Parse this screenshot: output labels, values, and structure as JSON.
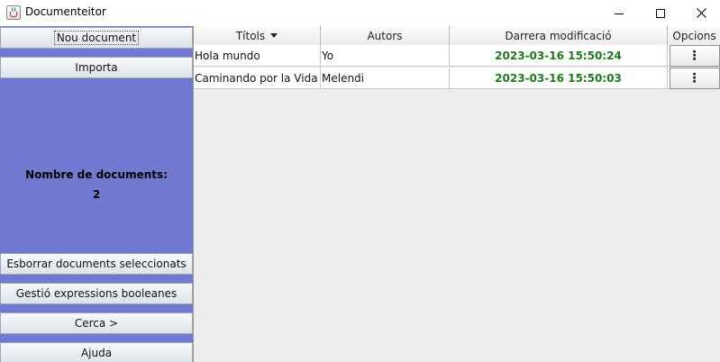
{
  "window": {
    "title": "Documenteitor",
    "icon": "java-cup-icon"
  },
  "sidebar": {
    "new_document": "Nou document",
    "import": "Importa",
    "count_label": "Nombre de documents:",
    "count_value": "2",
    "delete_selected": "Esborrar documents seleccionats",
    "boolean_expressions": "Gestió expressions booleanes",
    "search": "Cerca >",
    "help": "Ajuda"
  },
  "table": {
    "columns": [
      "Títols",
      "Autors",
      "Darrera modificació",
      "Opcions"
    ],
    "sorted_column": "Títols",
    "rows": [
      {
        "title": "Hola mundo",
        "author": "Yo",
        "modified": "2023-03-16 15:50:24",
        "options": "⋮"
      },
      {
        "title": "Caminando por la Vida",
        "author": "Melendi",
        "modified": "2023-03-16 15:50:03",
        "options": "⋮"
      }
    ]
  },
  "colors": {
    "sidebar_bg": "#7279d0",
    "date_text": "#1f7a1f",
    "table_bg": "#ececec"
  }
}
